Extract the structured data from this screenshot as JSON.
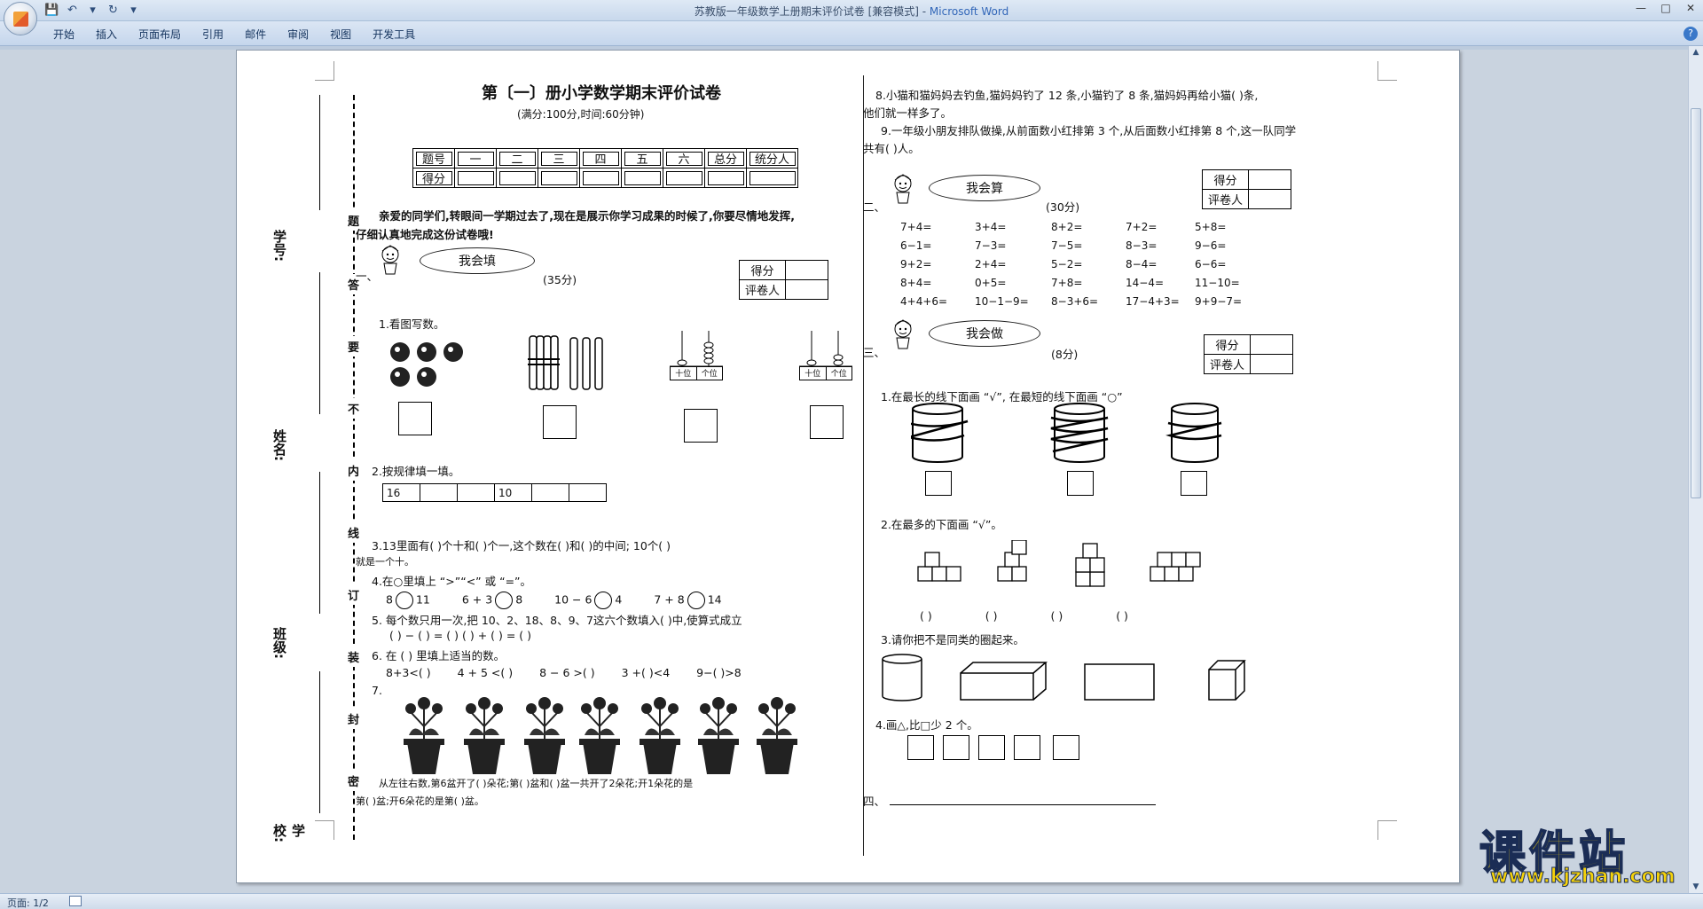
{
  "window": {
    "title": "苏教版一年级数学上册期末评价试卷 [兼容模式] - ",
    "app": "Microsoft Word",
    "controls": [
      "—",
      "□",
      "✕"
    ]
  },
  "qat": [
    "💾",
    "↶",
    "▾",
    "↻",
    "▾"
  ],
  "ribbon": {
    "tabs": [
      "开始",
      "插入",
      "页面布局",
      "引用",
      "邮件",
      "审阅",
      "视图",
      "开发工具"
    ],
    "help": "?"
  },
  "status": {
    "page": "页面: 1/2"
  },
  "binding": {
    "labels": [
      "学号:",
      "姓名:",
      "班级:",
      "学校:"
    ],
    "chars": [
      "题",
      "答",
      "要",
      "不",
      "内",
      "线",
      "订",
      "装",
      "封",
      "密"
    ]
  },
  "left": {
    "title": "第〔一〕册小学数学期末评价试卷",
    "subtitle": "(满分:100分,时间:60分钟)",
    "score_table": {
      "row1": [
        "题号",
        "一",
        "二",
        "三",
        "四",
        "五",
        "六",
        "总分",
        "统分人"
      ],
      "row2": "得分"
    },
    "intro1": "亲爱的同学们,转眼间一学期过去了,现在是展示你学习成果的时候了,你要尽情地发挥,",
    "intro2": "仔细认真地完成这份试卷哦!",
    "sec1": {
      "num": "一、",
      "badge": "我会填",
      "points": "(35分)"
    },
    "scorer": {
      "score": "得分",
      "grader": "评卷人"
    },
    "q1": "1.看图写数。",
    "abacus": {
      "tens": "十位",
      "ones": "个位"
    },
    "q2": "2.按规律填一填。",
    "seq": [
      "16",
      "",
      "",
      "10",
      "",
      ""
    ],
    "q3a": "3.13里面有(   )个十和(   )个一,这个数在(    )和(    )的中间;  10个(  )",
    "q3b": "就是一个十。",
    "q4": "4.在○里填上 “>”“<” 或 “=”。",
    "q4items": [
      {
        "l": "8",
        "r": "11"
      },
      {
        "l": "6 + 3",
        "r": "8"
      },
      {
        "l": "10 − 6",
        "r": "4"
      },
      {
        "l": "7 + 8",
        "r": "14"
      }
    ],
    "q5a": "5. 每个数只用一次,把 10、2、18、8、9、7这六个数填入(   )中,使算式成立",
    "q5b": "(   ) − (   ) = (   )           (   ) + (   ) = (   )",
    "q6": "6. 在 ( ) 里填上适当的数。",
    "q6items": [
      "8+3<(    )",
      "4 + 5 <(    )",
      "8 − 6 >(  )",
      "3 +(  )<4",
      "9−(  )>8"
    ],
    "q7": "7.",
    "q7a": "从左往右数,第6盆开了(   )朵花;第(   )盆和(   )盆一共开了2朵花;开1朵花的是",
    "q7b": "第(   )盆;开6朵花的是第(   )盆。"
  },
  "right": {
    "q8a": "8.小猫和猫妈妈去钓鱼,猫妈妈钓了 12 条,小猫钓了 8 条,猫妈妈再给小猫(     )条,",
    "q8b": "他们就一样多了。",
    "q9a": "9.一年级小朋友排队做操,从前面数小红排第 3 个,从后面数小红排第 8 个,这一队同学",
    "q9b": "共有(       )人。",
    "sec2": {
      "num": "二、",
      "badge": "我会算",
      "points": "(30分)"
    },
    "calc": [
      [
        "7+4=",
        "3+4=",
        "8+2=",
        "7+2=",
        "5+8="
      ],
      [
        "6−1=",
        "7−3=",
        "7−5=",
        "8−3=",
        "9−6="
      ],
      [
        "9+2=",
        "2+4=",
        "5−2=",
        "8−4=",
        "6−6="
      ],
      [
        "8+4=",
        "0+5=",
        "7+8=",
        "14−4=",
        "11−10="
      ],
      [
        "4+4+6=",
        "10−1−9=",
        "8−3+6=",
        "17−4+3=",
        "9+9−7="
      ]
    ],
    "sec3": {
      "num": "三、",
      "badge": "我会做",
      "points": "(8分)"
    },
    "r1": "1.在最长的线下面画 “√”, 在最短的线下面画 “○”",
    "r2": "2.在最多的下面画 “√”。",
    "r2blanks": [
      "(     )",
      "(     )",
      "(     )",
      "(     )"
    ],
    "r3": "3.请你把不是同类的圈起来。",
    "r4": "4.画△,比□少 2 个。",
    "sec4": "四、"
  },
  "watermark": {
    "big": "课件站",
    "url": "www.kjzhan.com"
  }
}
